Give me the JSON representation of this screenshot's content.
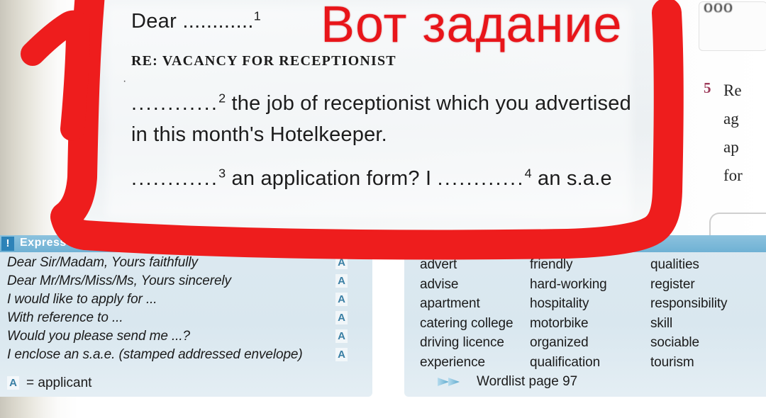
{
  "annotation": {
    "russian_note": "Вот задание",
    "handwritten_number": "1",
    "ink_color": "#ee1d1d"
  },
  "letter": {
    "salutation": "Dear ............",
    "salutation_ref": "1",
    "subject": "RE: VACANCY FOR RECEPTIONIST",
    "para1_gap_ref": "2",
    "para1_text": " the job of receptionist which you advertised in this month's Hotelkeeper.",
    "para2_gap_ref": "3",
    "para2_a": " an application form? I ",
    "para2_gap2_ref": "4",
    "para2_b": " an s.a.e",
    "gap_dots": "............"
  },
  "right_column": {
    "top_cut_text": "ооо",
    "exercise_number": "5",
    "lines": [
      "Re",
      "ag",
      "ap",
      "for"
    ]
  },
  "expressions": {
    "header_badge": "!",
    "header_title": "Express",
    "items": [
      {
        "text": "Dear Sir/Madam, Yours faithfully",
        "tag": "A"
      },
      {
        "text": "Dear Mr/Mrs/Miss/Ms, Yours sincerely",
        "tag": "A"
      },
      {
        "text": "I would like to apply for ...",
        "tag": "A"
      },
      {
        "text": "With reference to ...",
        "tag": "A"
      },
      {
        "text": "Would you please send me ...?",
        "tag": "A"
      },
      {
        "text": "I enclose an s.a.e. (stamped addressed envelope)",
        "tag": "A"
      }
    ],
    "key_symbol": "A",
    "key_text": "= applicant"
  },
  "wordlist": {
    "columns": [
      [
        "advert",
        "advise",
        "apartment",
        "catering college",
        "driving licence",
        "experience"
      ],
      [
        "friendly",
        "hard-working",
        "hospitality",
        "motorbike",
        "organized",
        "qualification"
      ],
      [
        "qualities",
        "register",
        "responsibility",
        "skill",
        "sociable",
        "tourism"
      ]
    ],
    "reference": "Wordlist page 97",
    "reference_icon": "double-chevron-right-icon"
  }
}
